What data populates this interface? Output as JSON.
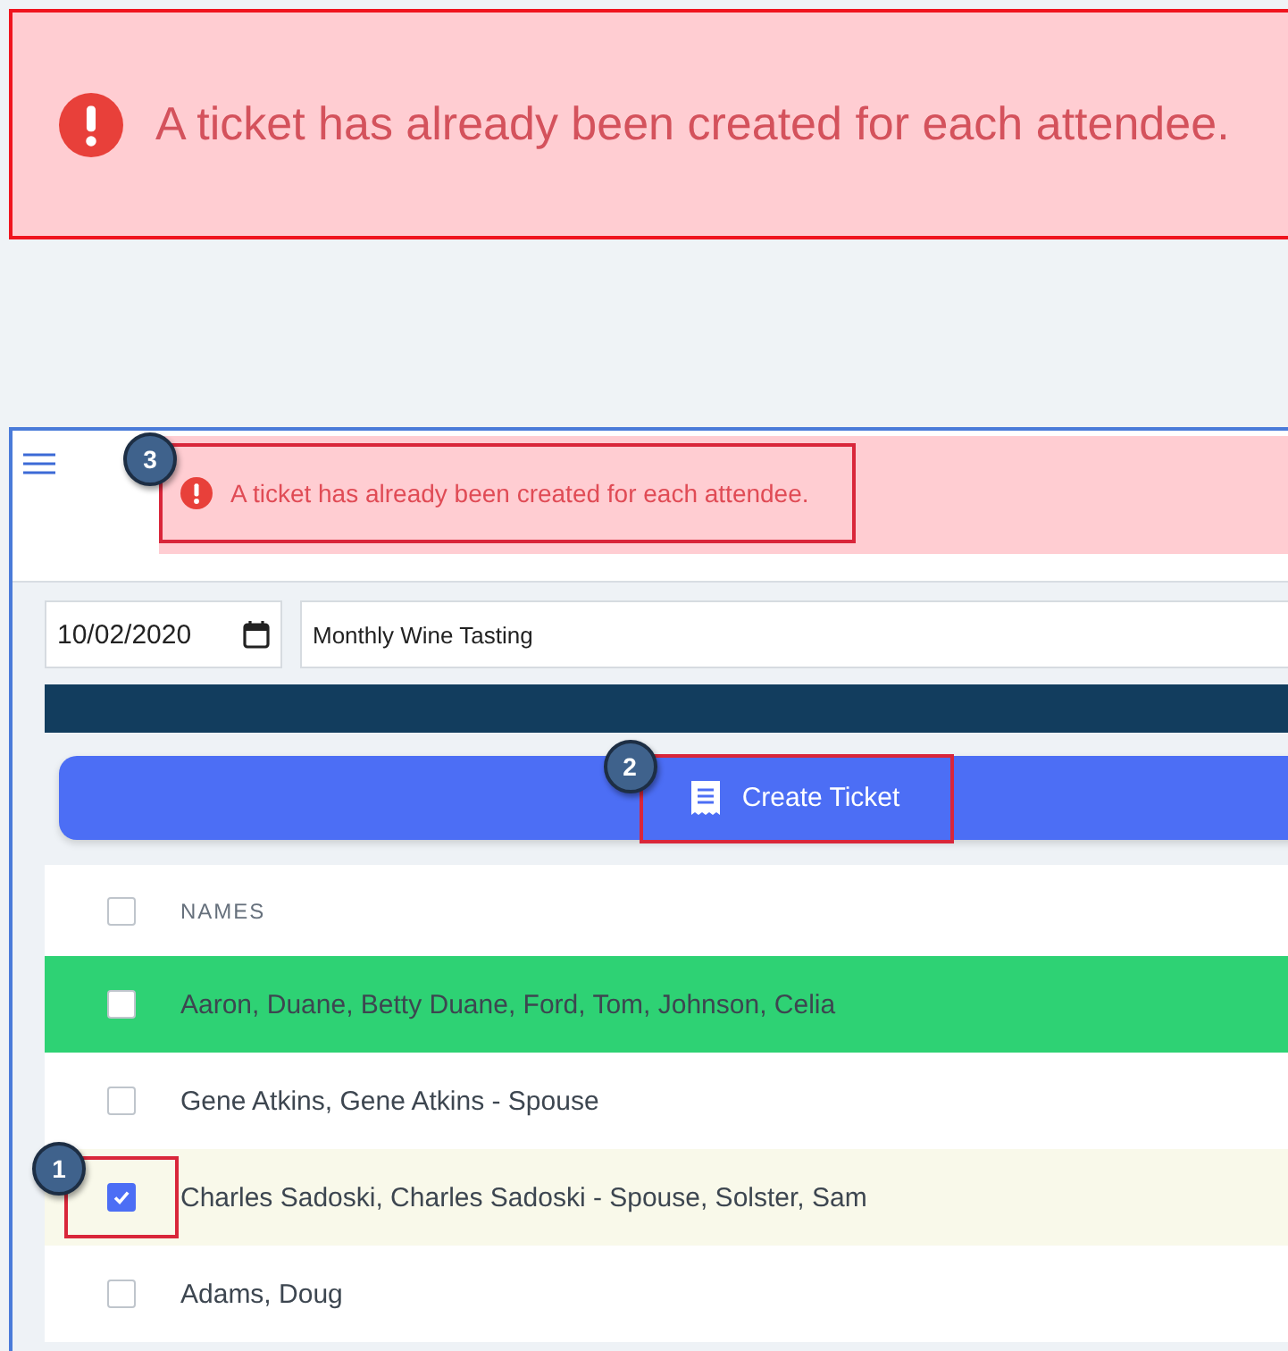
{
  "banner": {
    "message": "A ticket has already been created for each attendee."
  },
  "header": {
    "toast": {
      "message": "A ticket has already been created for each attendee.",
      "callout": "3"
    }
  },
  "filters": {
    "date": "10/02/2020",
    "event": "Monthly Wine Tasting"
  },
  "create_button": {
    "label": "Create Ticket",
    "callout": "2"
  },
  "table": {
    "columns": [
      "NAMES"
    ],
    "header_checked": false,
    "rows": [
      {
        "names": "Aaron, Duane, Betty Duane, Ford, Tom, Johnson, Celia",
        "checked": false,
        "ticket_created": true
      },
      {
        "names": "Gene Atkins, Gene Atkins - Spouse",
        "checked": false,
        "ticket_created": false
      },
      {
        "names": "Charles Sadoski, Charles Sadoski - Spouse, Solster, Sam",
        "checked": true,
        "ticket_created": false,
        "callout": "1"
      },
      {
        "names": "Adams, Doug",
        "checked": false,
        "ticket_created": false
      }
    ]
  }
}
